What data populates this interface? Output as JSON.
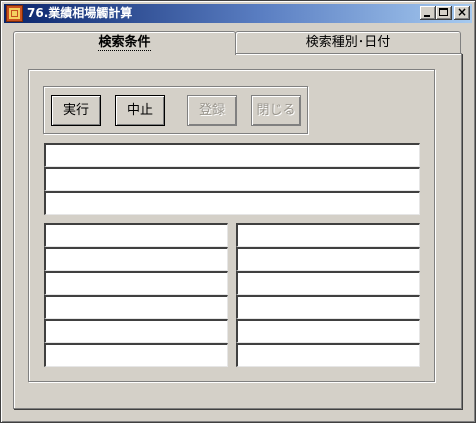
{
  "window": {
    "title": "76.業績相場觸計算",
    "controls": [
      "minimize",
      "maximize",
      "close"
    ],
    "close_glyph": "×"
  },
  "tabs": [
    {
      "label": "検索条件",
      "active": true
    },
    {
      "label": "検索種別･日付",
      "active": false
    }
  ],
  "buttons": {
    "run": "実行",
    "stop": "中止",
    "register": "登録",
    "close": "閉じる"
  },
  "disabled": [
    "register",
    "close"
  ],
  "fields": {
    "wide": [
      "",
      "",
      ""
    ],
    "left": [
      "",
      "",
      "",
      "",
      "",
      ""
    ],
    "right": [
      "",
      "",
      "",
      "",
      "",
      ""
    ]
  },
  "colors": {
    "face": "#d4d0c8",
    "titlebar_start": "#0a246a",
    "titlebar_end": "#a6caf0",
    "disabled_text": "#9a968e"
  }
}
